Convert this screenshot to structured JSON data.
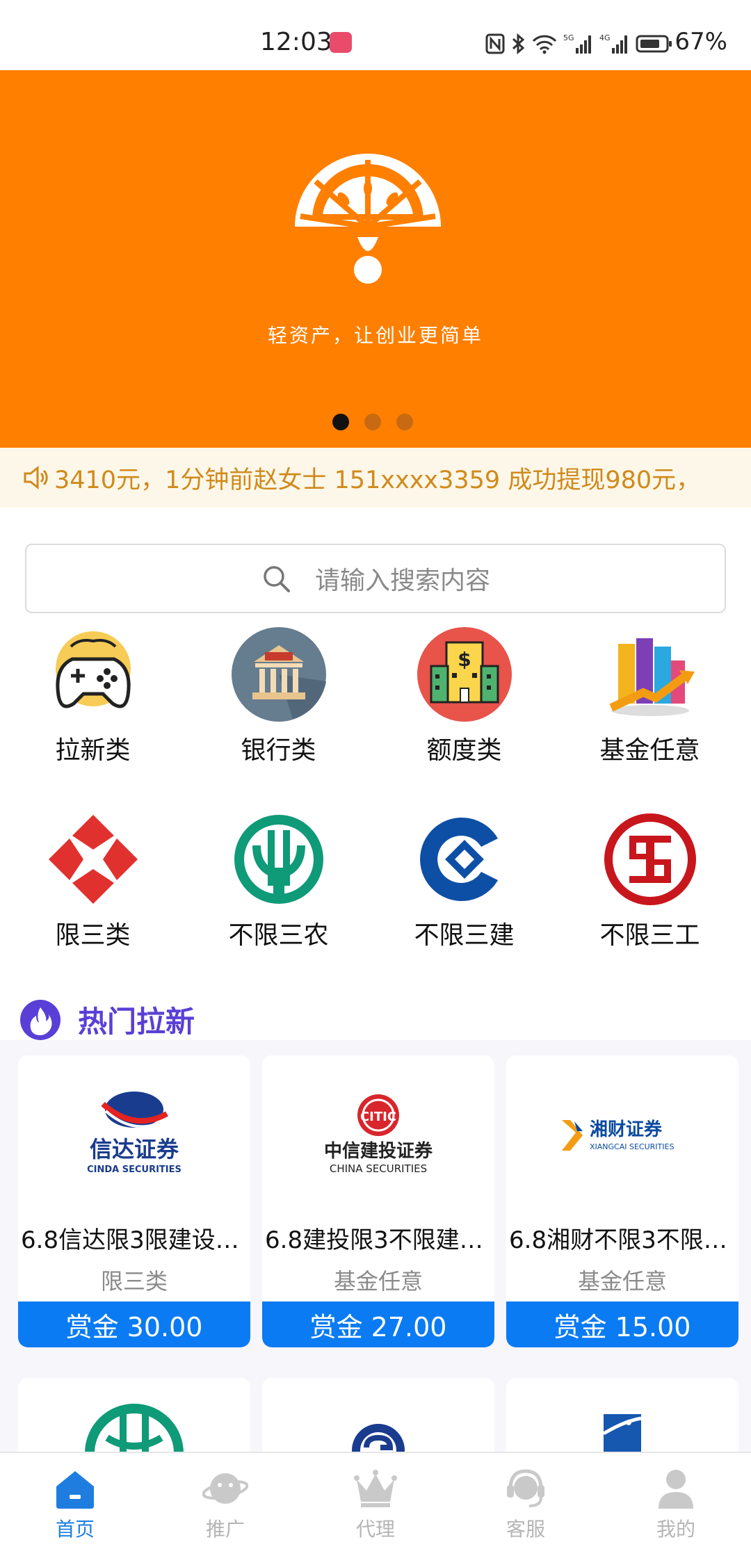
{
  "status_bar": {
    "time": "12:03",
    "network": "5G 4G",
    "battery": "67%"
  },
  "banner": {
    "slogan": "轻资产，让创业更简单",
    "page_count": 3,
    "current_page": 1
  },
  "notice": {
    "text": "3410元，1分钟前赵女士 151xxxx3359 成功提现980元，"
  },
  "search": {
    "placeholder": "请输入搜索内容"
  },
  "categories": [
    {
      "label": "拉新类",
      "icon": "gamepad-icon"
    },
    {
      "label": "银行类",
      "icon": "bank-icon"
    },
    {
      "label": "额度类",
      "icon": "building-dollar-icon"
    },
    {
      "label": "基金任意",
      "icon": "fund-chart-icon"
    },
    {
      "label": "限三类",
      "icon": "diamond-logo-icon"
    },
    {
      "label": "不限三农",
      "icon": "abc-bank-icon"
    },
    {
      "label": "不限三建",
      "icon": "ccb-bank-icon"
    },
    {
      "label": "不限三工",
      "icon": "icbc-bank-icon"
    }
  ],
  "hot_section": {
    "title": "热门拉新"
  },
  "products": [
    {
      "brand": "信达证券",
      "brand_en": "CINDA SECURITIES",
      "title": "6.8信达限3限建设…",
      "category": "限三类",
      "reward": "赏金 30.00"
    },
    {
      "brand": "中信建投证券",
      "brand_en": "CHINA SECURITIES",
      "title": "6.8建投限3不限建…",
      "category": "基金任意",
      "reward": "赏金 27.00"
    },
    {
      "brand": "湘财证券",
      "brand_en": "XIANGCAI SECURITIES",
      "title": "6.8湘财不限3不限…",
      "category": "基金任意",
      "reward": "赏金 15.00"
    }
  ],
  "tabs": [
    {
      "label": "首页",
      "icon": "home-icon",
      "active": true
    },
    {
      "label": "推广",
      "icon": "planet-icon",
      "active": false
    },
    {
      "label": "代理",
      "icon": "crown-icon",
      "active": false
    },
    {
      "label": "客服",
      "icon": "headset-icon",
      "active": false
    },
    {
      "label": "我的",
      "icon": "user-icon",
      "active": false
    }
  ],
  "colors": {
    "banner": "#ff7f00",
    "accent": "#0a7bf2",
    "hot_title": "#5a3fd6",
    "notice_text": "#d08a1a"
  }
}
